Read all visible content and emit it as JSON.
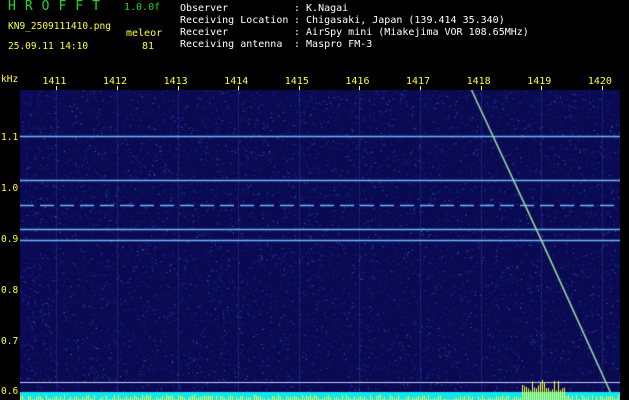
{
  "header": {
    "app_name": "HROFFT",
    "version": "1.0.0f",
    "filename": "KN9_2509111410.png",
    "mode_tag": "meleor",
    "datetime": "25.09.11 14:10",
    "count": "81",
    "info": [
      {
        "label": "Observer",
        "value": ": K.Nagai"
      },
      {
        "label": "Receiving Location",
        "value": ": Chigasaki, Japan (139.414 35.340)"
      },
      {
        "label": "Receiver",
        "value": ": AirSpy mini (Miakejima VOR 108.65MHz)"
      },
      {
        "label": "Receiving antenna",
        "value": ": Maspro FM-3"
      }
    ]
  },
  "chart_data": {
    "type": "heatmap",
    "ylabel": "kHz",
    "x_ticks": [
      "1411",
      "1412",
      "1413",
      "1414",
      "1415",
      "1416",
      "1417",
      "1418",
      "1419",
      "1420"
    ],
    "y_ticks": [
      "1.1",
      "1.0",
      "0.9",
      "0.8",
      "0.7",
      "0.6"
    ],
    "y_tick_values": [
      1.1,
      1.0,
      0.9,
      0.8,
      0.7,
      0.6
    ],
    "ylim": [
      0.585,
      1.195
    ],
    "xlim": [
      1410.4,
      1420.3
    ],
    "carriers_khz": [
      1.105,
      1.017,
      0.969,
      0.921,
      0.899
    ],
    "reference_line_khz": 0.62,
    "meteor_trace": {
      "x": [
        1417.85,
        1419.0,
        1420.2
      ],
      "y": [
        1.195,
        0.9,
        0.585
      ]
    },
    "colors": {
      "background": "#0a0a52",
      "noise": "#2a3cb0",
      "carrier": "#6fb8ff",
      "trace": "#9fe0a0",
      "bottom_bar": "#11e6ee",
      "bottom_spikes": "#ffff33"
    }
  }
}
